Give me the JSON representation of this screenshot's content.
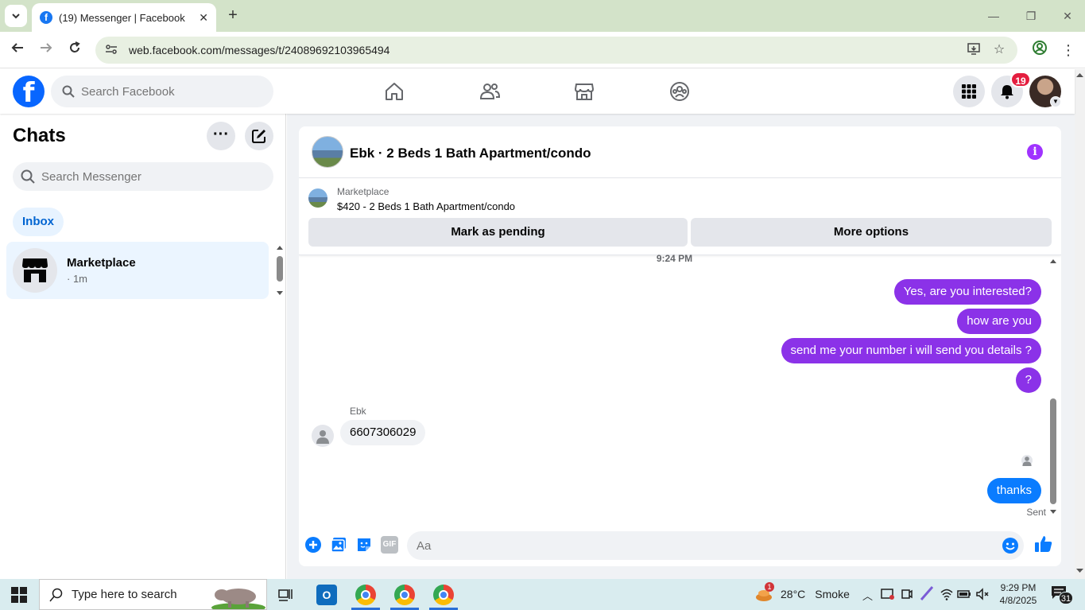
{
  "browser": {
    "tab_title": "(19) Messenger | Facebook",
    "url": "web.facebook.com/messages/t/24089692103965494"
  },
  "fb": {
    "search_placeholder": "Search Facebook",
    "notification_count": "19",
    "brand_color": "#0866ff"
  },
  "chats": {
    "title": "Chats",
    "more_label": "···",
    "search_placeholder": "Search Messenger",
    "inbox_label": "Inbox",
    "items": [
      {
        "name": "Marketplace",
        "time": "· 1m"
      }
    ]
  },
  "conversation": {
    "title": "Ebk · 2 Beds 1 Bath Apartment/condo",
    "marketplace_label": "Marketplace",
    "listing": "$420 - 2 Beds 1 Bath Apartment/condo",
    "mark_pending_label": "Mark as pending",
    "more_options_label": "More options",
    "timestamp": "9:24 PM",
    "messages_out": [
      "Yes, are you interested?",
      "how are you",
      "send me your number i will send you details ?",
      "?"
    ],
    "sender_name": "Ebk",
    "incoming_message": "6607306029",
    "last_message": "thanks",
    "status": "Sent",
    "composer_placeholder": "Aa",
    "gif_label": "GIF",
    "outgoing_color": "#8b32e8",
    "last_message_color": "#0a7cff"
  },
  "taskbar": {
    "search_placeholder": "Type here to search",
    "weather_badge": "1",
    "temperature": "28°C",
    "weather_text": "Smoke",
    "time": "9:29 PM",
    "date": "4/8/2025",
    "notification_count": "31"
  }
}
